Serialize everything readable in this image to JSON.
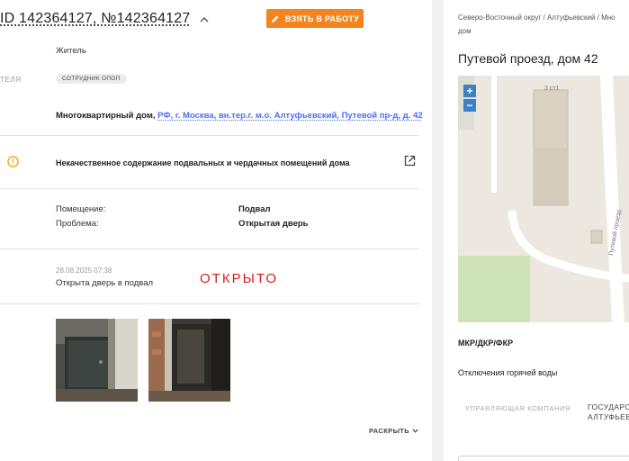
{
  "header": {
    "id_text": "ID 142364127, №142364127",
    "take_button_label": "ВЗЯТЬ В РАБОТУ",
    "accent_color": "#f5841f"
  },
  "applicant": {
    "role": "Житель",
    "row_label_partial": "ТЕЛЯ",
    "badge": "СОТРУДНИК ОПОП"
  },
  "object": {
    "type": "Многоквартирный дом,",
    "address": "РФ, г. Москва, вн.тер.г. м.о. Алтуфьевский, Путевой пр-д, д. 42"
  },
  "category": {
    "text": "Некачественное содержание подвальных и чердачных помещений дома",
    "icon": "warning-circle-icon",
    "link_icon": "external-link-icon"
  },
  "details": {
    "rows": [
      {
        "label": "Помещение:",
        "value": "Подвал"
      },
      {
        "label": "Проблема:",
        "value": "Открытая дверь"
      }
    ]
  },
  "message": {
    "date": "28.08.2025 07:38",
    "text": "Открыта дверь в подвал",
    "status": "ОТКРЫТО",
    "status_color": "#d81e1e"
  },
  "photos": [
    "basement-door-photo-1",
    "basement-door-photo-2"
  ],
  "expand_label": "РАСКРЫТЬ",
  "right_panel": {
    "breadcrumb_line1": "Северо-Восточный округ / Алтуфьевский / Мно",
    "breadcrumb_line2": "дом",
    "title": "Путевой проезд, дом 42",
    "map": {
      "zoom_in": "+",
      "zoom_out": "−",
      "building_label": "3 ст1",
      "street_label": "Путевой проезд"
    },
    "mkr_label": "МКР/ДКР/ФКР",
    "hot_water_label": "Отключения горячей воды",
    "mgmt_label": "УПРАВЛЯЮЩАЯ КОМПАНИЯ",
    "mgmt_value_line1": "ГОСУДАРС",
    "mgmt_value_line2": "АЛТУФЬЕВ"
  }
}
